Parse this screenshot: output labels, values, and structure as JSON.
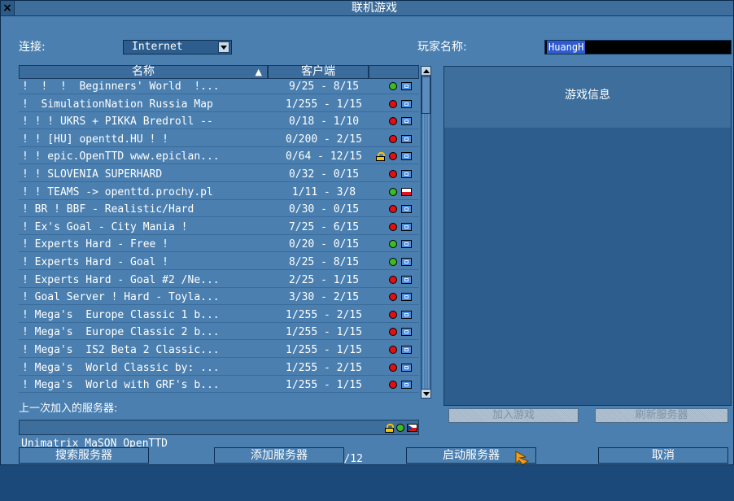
{
  "window": {
    "title": "联机游戏",
    "close_glyph": "×"
  },
  "connection": {
    "label": "连接:",
    "value": "Internet"
  },
  "player": {
    "label": "玩家名称:",
    "value": "HuangH"
  },
  "list": {
    "col_name": "名称",
    "col_clients": "客户端",
    "sort_glyph": "▲",
    "rows": [
      {
        "name": "!  !  !  Beginners' World  !...",
        "clients": "9/25 - 8/15",
        "status": "green",
        "flag": "eu",
        "lock": false
      },
      {
        "name": "!  SimulationNation Russia Map",
        "clients": "1/255 - 1/15",
        "status": "red",
        "flag": "eu",
        "lock": false
      },
      {
        "name": "! ! ! UKRS + PIKKA Bredroll --",
        "clients": "0/18 - 1/10",
        "status": "red",
        "flag": "eu",
        "lock": false
      },
      {
        "name": "! ! [HU] openttd.HU ! !",
        "clients": "0/200 - 2/15",
        "status": "red",
        "flag": "eu",
        "lock": false
      },
      {
        "name": "! ! epic.OpenTTD www.epiclan...",
        "clients": "0/64 - 12/15",
        "status": "red",
        "flag": "eu",
        "lock": true
      },
      {
        "name": "! ! SLOVENIA SUPERHARD",
        "clients": "0/32 - 0/15",
        "status": "red",
        "flag": "eu",
        "lock": false
      },
      {
        "name": "! ! TEAMS -> openttd.prochy.pl",
        "clients": "1/11 - 3/8",
        "status": "green",
        "flag": "pl",
        "lock": false
      },
      {
        "name": "! BR ! BBF - Realistic/Hard",
        "clients": "0/30 - 0/15",
        "status": "red",
        "flag": "eu",
        "lock": false
      },
      {
        "name": "! Ex's Goal - City Mania !",
        "clients": "7/25 - 6/15",
        "status": "red",
        "flag": "eu",
        "lock": false
      },
      {
        "name": "! Experts Hard - Free !",
        "clients": "0/20 - 0/15",
        "status": "green",
        "flag": "eu",
        "lock": false
      },
      {
        "name": "! Experts Hard - Goal !",
        "clients": "8/25 - 8/15",
        "status": "green",
        "flag": "eu",
        "lock": false
      },
      {
        "name": "! Experts Hard - Goal #2 /Ne...",
        "clients": "2/25 - 1/15",
        "status": "red",
        "flag": "eu",
        "lock": false
      },
      {
        "name": "! Goal Server ! Hard - Toyla...",
        "clients": "3/30 - 2/15",
        "status": "red",
        "flag": "eu",
        "lock": false
      },
      {
        "name": "! Mega's  Europe Classic 1 b...",
        "clients": "1/255 - 2/15",
        "status": "red",
        "flag": "eu",
        "lock": false
      },
      {
        "name": "! Mega's  Europe Classic 2 b...",
        "clients": "1/255 - 1/15",
        "status": "red",
        "flag": "eu",
        "lock": false
      },
      {
        "name": "! Mega's  IS2 Beta 2 Classic...",
        "clients": "1/255 - 1/15",
        "status": "red",
        "flag": "eu",
        "lock": false
      },
      {
        "name": "! Mega's  World Classic by: ...",
        "clients": "1/255 - 2/15",
        "status": "red",
        "flag": "eu",
        "lock": false
      },
      {
        "name": "! Mega's  World with GRF's b...",
        "clients": "1/255 - 1/15",
        "status": "red",
        "flag": "eu",
        "lock": false
      }
    ]
  },
  "last_server": {
    "label": "上一次加入的服务器:",
    "name": "Unimatrix MaSON OpenTTD",
    "clients": "1/100 - 6/12",
    "status": "green",
    "flag": "cz",
    "lock": true
  },
  "info": {
    "title": "游戏信息",
    "join": "加入游戏",
    "refresh": "刷新服务器"
  },
  "buttons": {
    "find": "搜索服务器",
    "add": "添加服务器",
    "start": "启动服务器",
    "cancel": "取消"
  },
  "colors": {
    "window_bg": "#4a7fb0",
    "info_bg": "#2c5d8c",
    "status_red": "#e01010",
    "status_green": "#3cbc22",
    "name_highlight": "#2f5bd1"
  }
}
